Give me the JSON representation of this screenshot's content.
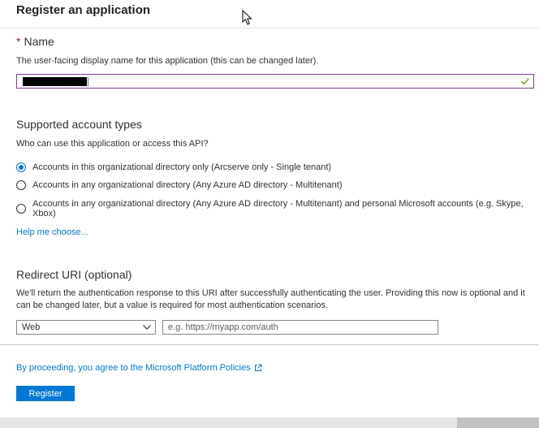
{
  "page": {
    "title": "Register an application"
  },
  "name_section": {
    "required_marker": "*",
    "label": "Name",
    "description": "The user-facing display name for this application (this can be changed later).",
    "value_redacted": true,
    "valid_icon": "checkmark-icon"
  },
  "account_types": {
    "heading": "Supported account types",
    "question": "Who can use this application or access this API?",
    "options": [
      {
        "label": "Accounts in this organizational directory only (Arcserve only - Single tenant)",
        "selected": true
      },
      {
        "label": "Accounts in any organizational directory (Any Azure AD directory - Multitenant)",
        "selected": false
      },
      {
        "label": "Accounts in any organizational directory (Any Azure AD directory - Multitenant) and personal Microsoft accounts (e.g. Skype, Xbox)",
        "selected": false
      }
    ],
    "help_link": "Help me choose..."
  },
  "redirect": {
    "heading": "Redirect URI (optional)",
    "description": "We'll return the authentication response to this URI after successfully authenticating the user. Providing this now is optional and it can be changed later, but a value is required for most authentication scenarios.",
    "platform_selected": "Web",
    "uri_value": "",
    "uri_placeholder": "e.g. https://myapp.com/auth"
  },
  "footer": {
    "policy_text": "By proceeding, you agree to the Microsoft Platform Policies",
    "register_label": "Register"
  },
  "colors": {
    "accent": "#0078d4",
    "valid": "#57a300",
    "required": "#a4262c",
    "focus_border": "#8a3c9a"
  }
}
